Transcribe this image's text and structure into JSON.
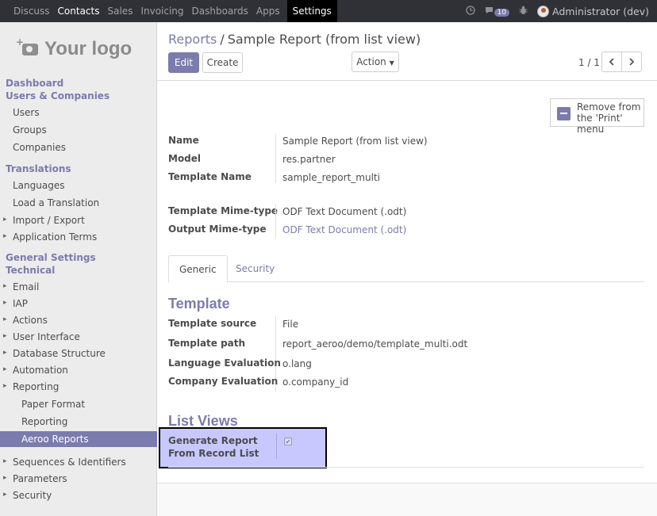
{
  "topbar": {
    "menu": [
      "Discuss",
      "Contacts",
      "Sales",
      "Invoicing",
      "Dashboards",
      "Apps",
      "Settings"
    ],
    "current": "Contacts",
    "active": "Settings",
    "clock_icon": "clock-icon",
    "messages_icon": "comments-icon",
    "message_count": "10",
    "debug_icon": "bug-icon",
    "user": "Administrator (dev)"
  },
  "sidebar": {
    "logo": "Your logo",
    "items": [
      {
        "label": "Dashboard",
        "kind": "h"
      },
      {
        "label": "Users & Companies",
        "kind": "h"
      },
      {
        "label": "Users",
        "kind": "i"
      },
      {
        "label": "Groups",
        "kind": "i"
      },
      {
        "label": "Companies",
        "kind": "i"
      },
      {
        "label": "Translations",
        "kind": "h"
      },
      {
        "label": "Languages",
        "kind": "i"
      },
      {
        "label": "Load a Translation",
        "kind": "i"
      },
      {
        "label": "Import / Export",
        "kind": "c"
      },
      {
        "label": "Application Terms",
        "kind": "c"
      },
      {
        "label": "General Settings",
        "kind": "h"
      },
      {
        "label": "Technical",
        "kind": "h"
      },
      {
        "label": "Email",
        "kind": "c"
      },
      {
        "label": "IAP",
        "kind": "c"
      },
      {
        "label": "Actions",
        "kind": "c"
      },
      {
        "label": "User Interface",
        "kind": "c"
      },
      {
        "label": "Database Structure",
        "kind": "c"
      },
      {
        "label": "Automation",
        "kind": "c"
      },
      {
        "label": "Reporting",
        "kind": "c"
      },
      {
        "label": "Paper Format",
        "kind": "sub"
      },
      {
        "label": "Reporting",
        "kind": "sub"
      },
      {
        "label": "Aeroo Reports",
        "kind": "active"
      },
      {
        "label": "Sequences & Identifiers",
        "kind": "c"
      },
      {
        "label": "Parameters",
        "kind": "c"
      },
      {
        "label": "Security",
        "kind": "c"
      }
    ]
  },
  "breadcrumb": {
    "parent": "Reports",
    "sep": "/",
    "current": "Sample Report (from list view)"
  },
  "buttons": {
    "edit": "Edit",
    "create": "Create",
    "action": "Action"
  },
  "pager": {
    "value": "1 / 1",
    "prev_icon": "chevron-left-icon",
    "next_icon": "chevron-right-icon"
  },
  "remove_button": {
    "line1": "Remove from",
    "line2": "the 'Print' menu"
  },
  "fields": [
    {
      "label": "Name",
      "value": "Sample Report (from list view)"
    },
    {
      "label": "Model",
      "value": "res.partner"
    },
    {
      "label": "Template Name",
      "value": "sample_report_multi"
    },
    {
      "label": "Template Mime-type",
      "value": "ODF Text Document (.odt)"
    },
    {
      "label": "Output Mime-type",
      "value": "ODF Text Document (.odt)"
    }
  ],
  "tabs": [
    "Generic",
    "Security"
  ],
  "template_section": {
    "title": "Template",
    "fields": [
      {
        "label": "Template source",
        "value": "File"
      },
      {
        "label": "Template path",
        "value": "report_aeroo/demo/template_multi.odt"
      },
      {
        "label": "Language Evaluation",
        "value": "o.lang"
      },
      {
        "label": "Company Evaluation",
        "value": "o.company_id"
      }
    ]
  },
  "list_views": {
    "title": "List Views",
    "label_line1": "Generate Report",
    "label_line2": "From Record List",
    "checked": true
  }
}
